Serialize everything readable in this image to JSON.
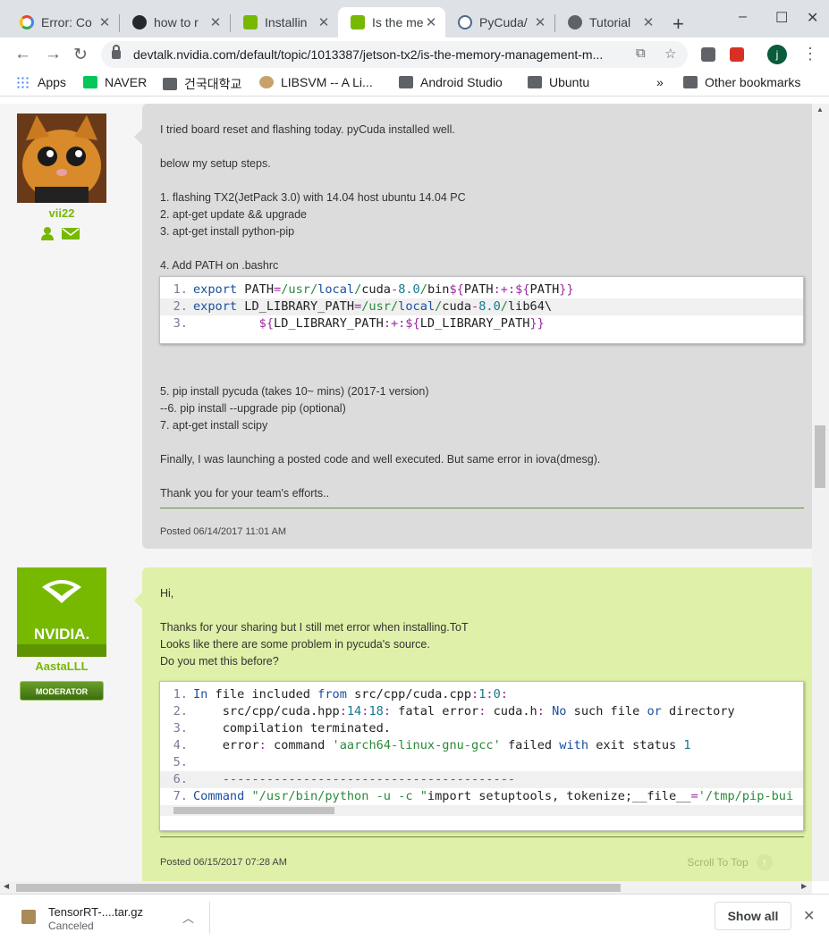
{
  "browser": {
    "tabs": [
      {
        "title": "Error: Co",
        "favicon": "google-icon"
      },
      {
        "title": "how to r",
        "favicon": "github-icon"
      },
      {
        "title": "Installin",
        "favicon": "nvidia-icon"
      },
      {
        "title": "Is the me",
        "favicon": "nvidia-icon",
        "active": true
      },
      {
        "title": "PyCuda/",
        "favicon": "pycuda-icon"
      },
      {
        "title": "Tutorial",
        "favicon": "globe-icon"
      }
    ],
    "new_tab": "+",
    "minimize": "–",
    "maximize": "☐",
    "close": "✕",
    "url": "devtalk.nvidia.com/default/topic/1013387/jetson-tx2/is-the-memory-management-m...",
    "profile_initial": "j"
  },
  "bookmarks": {
    "apps": "Apps",
    "items": [
      "NAVER",
      "건국대학교",
      "LIBSVM -- A Li...",
      "Android Studio",
      "Ubuntu"
    ],
    "overflow": "»",
    "other": "Other bookmarks"
  },
  "posts": [
    {
      "username": "vii22",
      "lines_before_code": [
        "I tried board reset and flashing today. pyCuda installed well.",
        "",
        "below my setup steps.",
        "",
        "1. flashing TX2(JetPack 3.0) with 14.04 host ubuntu 14.04 PC",
        "2. apt-get update && upgrade",
        "3. apt-get install python-pip",
        "",
        "4. Add PATH on .bashrc"
      ],
      "code_lines": [
        "export PATH=/usr/local/cuda-8.0/bin${PATH:+:${PATH}}",
        "export LD_LIBRARY_PATH=/usr/local/cuda-8.0/lib64\\",
        "         ${LD_LIBRARY_PATH:+:${LD_LIBRARY_PATH}}"
      ],
      "lines_after_code": [
        "",
        "",
        "5. pip install pycuda (takes 10~ mins) (2017-1 version)",
        "--6. pip install --upgrade pip (optional)",
        "7. apt-get install scipy",
        "",
        "Finally, I was launching a posted code and well executed. But same error in iova(dmesg).",
        "",
        "Thank you for your team's efforts.."
      ],
      "posted": "Posted 06/14/2017 11:01 AM"
    },
    {
      "username": "AastaLLL",
      "badge": "MODERATOR",
      "logo_text": "NVIDIA.",
      "lines_before_code": [
        "Hi,",
        "",
        "Thanks for your sharing but I still met error when installing.ToT",
        "Looks like there are some problem in pycuda's source.",
        "Do you met this before?"
      ],
      "code_lines": [
        "In file included from src/cpp/cuda.cpp:1:0:",
        "    src/cpp/cuda.hpp:14:18: fatal error: cuda.h: No such file or directory",
        "    compilation terminated.",
        "    error: command 'aarch64-linux-gnu-gcc' failed with exit status 1",
        "",
        "    ----------------------------------------",
        "Command \"/usr/bin/python -u -c \"import setuptools, tokenize;__file__='/tmp/pip-bui"
      ],
      "posted": "Posted 06/15/2017 07:28 AM",
      "scroll_to_top": "Scroll To Top"
    }
  ],
  "download_shelf": {
    "file_name": "TensorRT-....tar.gz",
    "status": "Canceled",
    "show_all": "Show all"
  },
  "colors": {
    "nvidia_green": "#76b900",
    "post_grey": "#dcdcdc",
    "post_green": "#dff0a8"
  }
}
